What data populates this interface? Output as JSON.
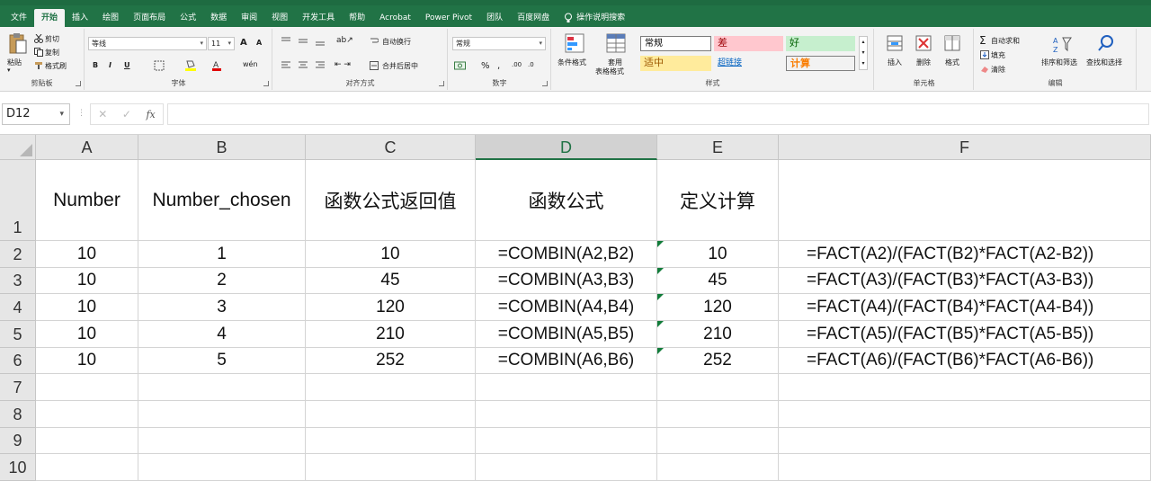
{
  "menu": {
    "items": [
      "文件",
      "开始",
      "插入",
      "绘图",
      "页面布局",
      "公式",
      "数据",
      "审阅",
      "视图",
      "开发工具",
      "帮助",
      "Acrobat",
      "Power Pivot",
      "团队",
      "百度网盘"
    ],
    "active": "开始",
    "search": "操作说明搜索"
  },
  "ribbon": {
    "clipboard": {
      "paste": "粘贴",
      "cut": "剪切",
      "copy": "复制",
      "format_painter": "格式刷",
      "label": "剪贴板"
    },
    "font": {
      "name": "等线",
      "size": "11",
      "label": "字体",
      "grow": "A",
      "shrink": "A"
    },
    "alignment": {
      "wrap": "自动换行",
      "merge": "合并后居中",
      "label": "对齐方式"
    },
    "number": {
      "format": "常规",
      "percent": "%",
      "comma": ",",
      "label": "数字"
    },
    "styles": {
      "conditional": "条件格式",
      "table": "套用",
      "table2": "表格格式",
      "normal": "常规",
      "bad": "差",
      "good": "好",
      "neutral": "适中",
      "hyperlink": "超链接",
      "calc": "计算",
      "label": "样式"
    },
    "cells": {
      "insert": "插入",
      "delete": "删除",
      "format": "格式",
      "label": "单元格"
    },
    "editing": {
      "autosum": "自动求和",
      "fill": "填充",
      "clear": "清除",
      "sort": "排序和筛选",
      "find": "查找和选择",
      "label": "编辑"
    }
  },
  "formula_bar": {
    "namebox": "D12",
    "fx": "fx",
    "value": ""
  },
  "columns": [
    "A",
    "B",
    "C",
    "D",
    "E",
    "F"
  ],
  "selected_column": "D",
  "rows": [
    "1",
    "2",
    "3",
    "4",
    "5",
    "6",
    "7",
    "8",
    "9",
    "10"
  ],
  "headers": [
    "Number",
    "Number_chosen",
    "函数公式返回值",
    "函数公式",
    "定义计算",
    ""
  ],
  "table": [
    [
      "10",
      "1",
      "10",
      "=COMBIN(A2,B2)",
      "10",
      "=FACT(A2)/(FACT(B2)*FACT(A2-B2))"
    ],
    [
      "10",
      "2",
      "45",
      "=COMBIN(A3,B3)",
      "45",
      "=FACT(A3)/(FACT(B3)*FACT(A3-B3))"
    ],
    [
      "10",
      "3",
      "120",
      "=COMBIN(A4,B4)",
      "120",
      "=FACT(A4)/(FACT(B4)*FACT(A4-B4))"
    ],
    [
      "10",
      "4",
      "210",
      "=COMBIN(A5,B5)",
      "210",
      "=FACT(A5)/(FACT(B5)*FACT(A5-B5))"
    ],
    [
      "10",
      "5",
      "252",
      "=COMBIN(A6,B6)",
      "252",
      "=FACT(A6)/(FACT(B6)*FACT(A6-B6))"
    ]
  ],
  "colors": {
    "excel_green": "#217346",
    "bad_fill": "#ffc7ce",
    "good_fill": "#c6efce",
    "neutral_fill": "#ffeb9c",
    "error_triangle": "#127c3a"
  }
}
